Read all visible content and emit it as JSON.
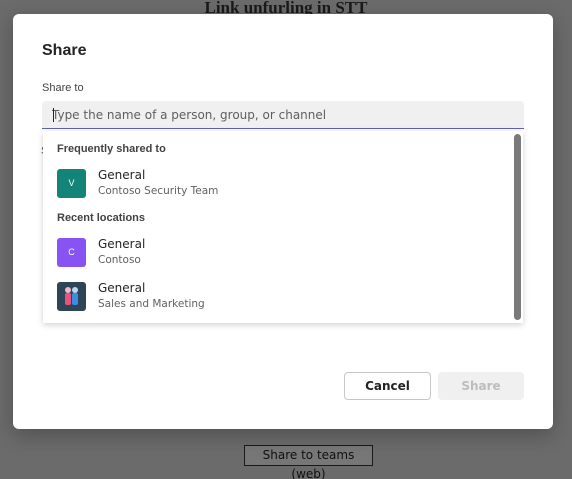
{
  "background": {
    "page_title": "Link unfurling in STT",
    "share_button_label": "Share to teams (web)"
  },
  "dialog": {
    "title": "Share",
    "share_to_label": "Share to",
    "search": {
      "placeholder": "Type the name of a person, group, or channel",
      "value": ""
    },
    "behind_char": "S",
    "frequent": {
      "header": "Frequently shared to",
      "items": [
        {
          "title": "General",
          "subtitle": "Contoso Security Team",
          "avatar_letter": "V",
          "avatar_color": "#148478"
        }
      ]
    },
    "recent": {
      "header": "Recent locations",
      "items": [
        {
          "title": "General",
          "subtitle": "Contoso",
          "avatar_letter": "C",
          "avatar_color": "#8753f2"
        },
        {
          "title": "General",
          "subtitle": "Sales and Marketing",
          "avatar_icon": "team-people-icon",
          "avatar_color": "#2e4558"
        }
      ]
    },
    "buttons": {
      "cancel": "Cancel",
      "share": "Share"
    }
  },
  "colors": {
    "accent": "#5b5fc7",
    "overlay": "#6b6b6b"
  }
}
